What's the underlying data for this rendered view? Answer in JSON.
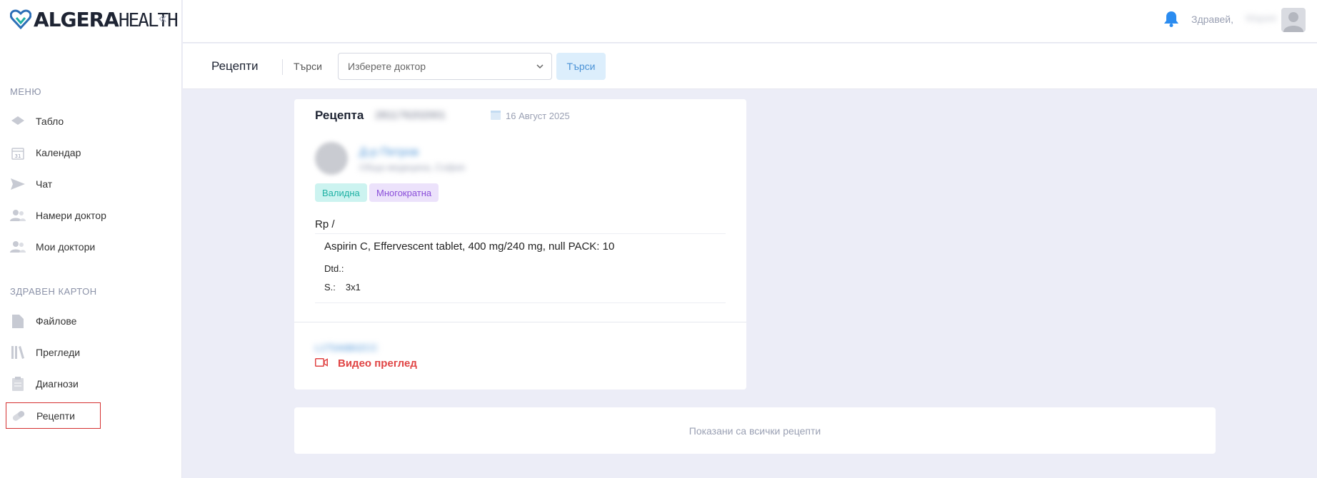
{
  "brand": {
    "bold": "ALGERA",
    "thin": "HEALTH"
  },
  "sidebar": {
    "sections": [
      {
        "label": "МЕНЮ",
        "items": [
          {
            "label": "Табло",
            "icon": "dashboard-icon"
          },
          {
            "label": "Календар",
            "icon": "calendar-icon"
          },
          {
            "label": "Чат",
            "icon": "send-icon"
          },
          {
            "label": "Намери доктор",
            "icon": "users-icon"
          },
          {
            "label": "Мои доктори",
            "icon": "users-icon"
          }
        ]
      },
      {
        "label": "ЗДРАВЕН КАРТОН",
        "items": [
          {
            "label": "Файлове",
            "icon": "file-icon"
          },
          {
            "label": "Прегледи",
            "icon": "books-icon"
          },
          {
            "label": "Диагнози",
            "icon": "clipboard-icon"
          },
          {
            "label": "Рецепти",
            "icon": "pill-icon",
            "active": true
          }
        ]
      }
    ]
  },
  "header": {
    "greeting": "Здравей,",
    "user_name": "Мария"
  },
  "filter": {
    "title": "Рецепти",
    "search_label": "Търси",
    "doctor_placeholder": "Изберете доктор",
    "search_button": "Търси"
  },
  "prescription": {
    "title": "Рецепта",
    "number": "281176202001",
    "date": "16 Август 2025",
    "doctor_name": "Д-р Петров",
    "doctor_specialty": "Обща медицина, София",
    "badges": {
      "valid": "Валидна",
      "multi": "Многократна"
    },
    "rp_label": "Rp /",
    "drug": "Aspirin C, Effervescent tablet, 400 mg/240 mg, null PACK: 10",
    "dtd": "Dtd.:",
    "sig_label": "S.:",
    "sig_value": "3x1",
    "exam_number": "L1T5A6B0ZCC",
    "exam_link": "Видео преглед"
  },
  "footer": {
    "info": "Показани са всички рецепти"
  },
  "colors": {
    "accent": "#4a92d6",
    "danger": "#e04444",
    "bg": "#ecedf7"
  }
}
